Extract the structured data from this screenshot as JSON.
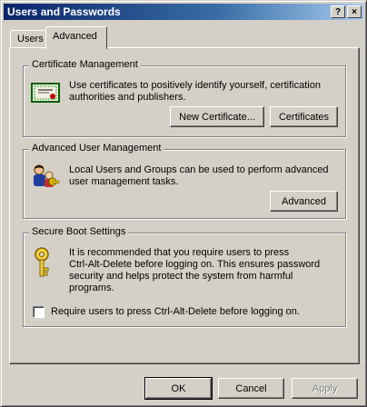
{
  "window": {
    "title": "Users and Passwords",
    "help_glyph": "?",
    "close_glyph": "×"
  },
  "tabs": [
    {
      "label": "Users",
      "active": false
    },
    {
      "label": "Advanced",
      "active": true
    }
  ],
  "certificate_management": {
    "legend": "Certificate Management",
    "description_line1": "Use certificates to positively identify yourself, certification",
    "description_line2": "authorities and publishers.",
    "new_certificate_label": "New Certificate...",
    "certificates_label": "Certificates"
  },
  "advanced_user_management": {
    "legend": "Advanced User Management",
    "description_line1": "Local Users and Groups can be used to perform advanced",
    "description_line2": "user management tasks.",
    "advanced_label": "Advanced"
  },
  "secure_boot": {
    "legend": "Secure Boot Settings",
    "description_line1": "It is recommended that you require users to press",
    "description_line2": "Ctrl-Alt-Delete before logging on. This ensures password",
    "description_line3": "security and helps protect the system from harmful",
    "description_line4": "programs.",
    "checkbox_label": "Require users to press Ctrl-Alt-Delete before logging on.",
    "checkbox_checked": false
  },
  "footer": {
    "ok_label": "OK",
    "cancel_label": "Cancel",
    "apply_label": "Apply"
  }
}
